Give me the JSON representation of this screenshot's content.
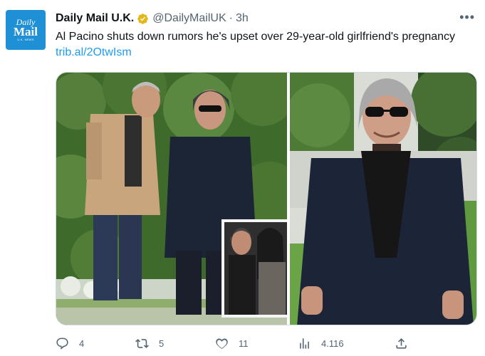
{
  "avatar": {
    "line1": "Daily",
    "line2": "Mail",
    "line3": "U.K. NEWS"
  },
  "tweet": {
    "name": "Daily Mail U.K.",
    "handle": "@DailyMailUK",
    "separator": "·",
    "time": "3h",
    "text": "Al Pacino shuts down rumors he's upset over 29-year-old girlfriend's pregnancy ",
    "link": "trib.al/2OtwIsm"
  },
  "actions": {
    "replies": "4",
    "retweets": "5",
    "likes": "11",
    "views": "4.116"
  },
  "colors": {
    "accent": "#1d9bf0",
    "muted": "#536471",
    "verified": "#e2b719",
    "avatar_bg": "#1f8fd6"
  },
  "icons": [
    "more-icon",
    "verified-badge-icon",
    "reply-icon",
    "retweet-icon",
    "like-icon",
    "views-icon",
    "share-icon"
  ]
}
